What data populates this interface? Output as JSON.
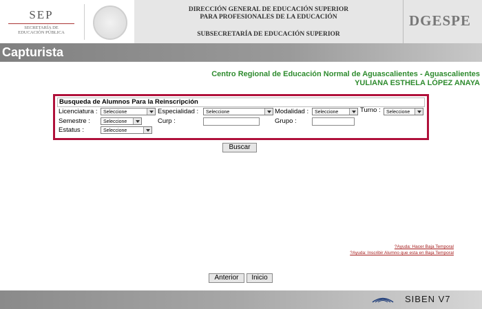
{
  "header": {
    "sep": "SEP",
    "sep_sub1": "SECRETARÍA DE",
    "sep_sub2": "EDUCACIÓN PÚBLICA",
    "direccion1": "DIRECCIÓN GENERAL DE EDUCACIÓN SUPERIOR",
    "direccion2": "PARA PROFESIONALES DE LA EDUCACIÓN",
    "subsecretaria": "SUBSECRETARÍA DE EDUCACIÓN SUPERIOR",
    "dgespe": "DGESPE"
  },
  "title_bar": {
    "title": "Capturista"
  },
  "institution": {
    "name": "Centro Regional de Educación Normal de Aguascalientes - Aguascalientes",
    "user": "YULIANA ESTHELA LÓPEZ ANAYA",
    "color": "#2e8b2e"
  },
  "search_panel": {
    "title": "Busqueda de Alumnos Para la Reinscripción",
    "licenciatura_label": "Licenciatura :",
    "licenciatura_value": "Seleccione",
    "especialidad_label": "Especialidad :",
    "especialidad_value": "Seleccione",
    "modalidad_label": "Modalidad :",
    "modalidad_value": "Seleccione",
    "turno_label": "Turno :",
    "turno_value": "Seleccione",
    "semestre_label": "Semestre :",
    "semestre_value": "Seleccione",
    "curp_label": "Curp :",
    "curp_value": "",
    "grupo_label": "Grupo :",
    "grupo_value": "",
    "estatus_label": "Estatus :",
    "estatus_value": "Seleccione",
    "border_color": "#b0103a"
  },
  "buttons": {
    "buscar": "Buscar",
    "anterior": "Anterior",
    "inicio": "Inicio"
  },
  "help_links": {
    "baja_temporal": "?Ayuda: Hacer Baja Temporal",
    "inscribir_baja": "?Ayuda: Inscribir Alumno que esta en Baja Temporal"
  },
  "footer": {
    "product": "SIBEN   V7"
  }
}
